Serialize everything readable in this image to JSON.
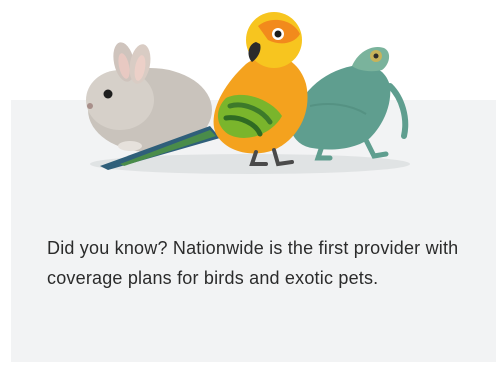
{
  "promo": {
    "caption": "Did you know? Nationwide is the first provider with coverage plans for birds and exotic pets.",
    "image": {
      "subjects": [
        "chinchilla",
        "sun-conure-parrot",
        "chameleon"
      ]
    }
  },
  "colors": {
    "card_background": "#f2f3f4",
    "page_background": "#ffffff",
    "text": "#2b2b2b"
  }
}
